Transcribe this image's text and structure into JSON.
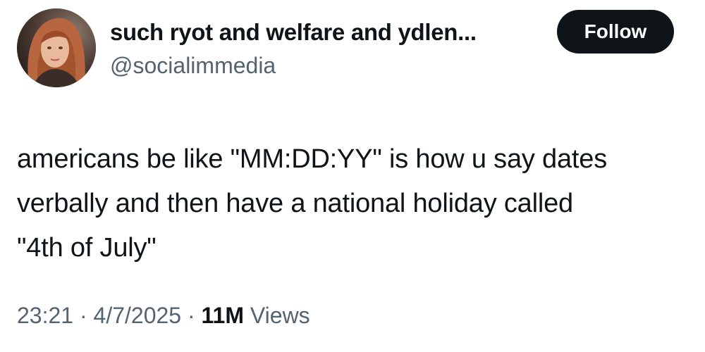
{
  "author": {
    "display_name": "such ryot and welfare and ydlen...",
    "handle": "@socialimmedia",
    "avatar_icon": "profile-photo"
  },
  "follow_button": {
    "label": "Follow"
  },
  "tweet": {
    "lines": [
      "americans be like \"MM:DD:YY\" is how u say dates",
      "verbally and then have a national holiday called",
      "\"4th of July\""
    ]
  },
  "meta": {
    "time": "23:21",
    "separator": "·",
    "date": "4/7/2025",
    "views_count": "11M",
    "views_label": "Views"
  },
  "colors": {
    "text_primary": "#0f1419",
    "text_secondary": "#536471",
    "button_bg": "#0f1419",
    "button_text": "#ffffff"
  }
}
